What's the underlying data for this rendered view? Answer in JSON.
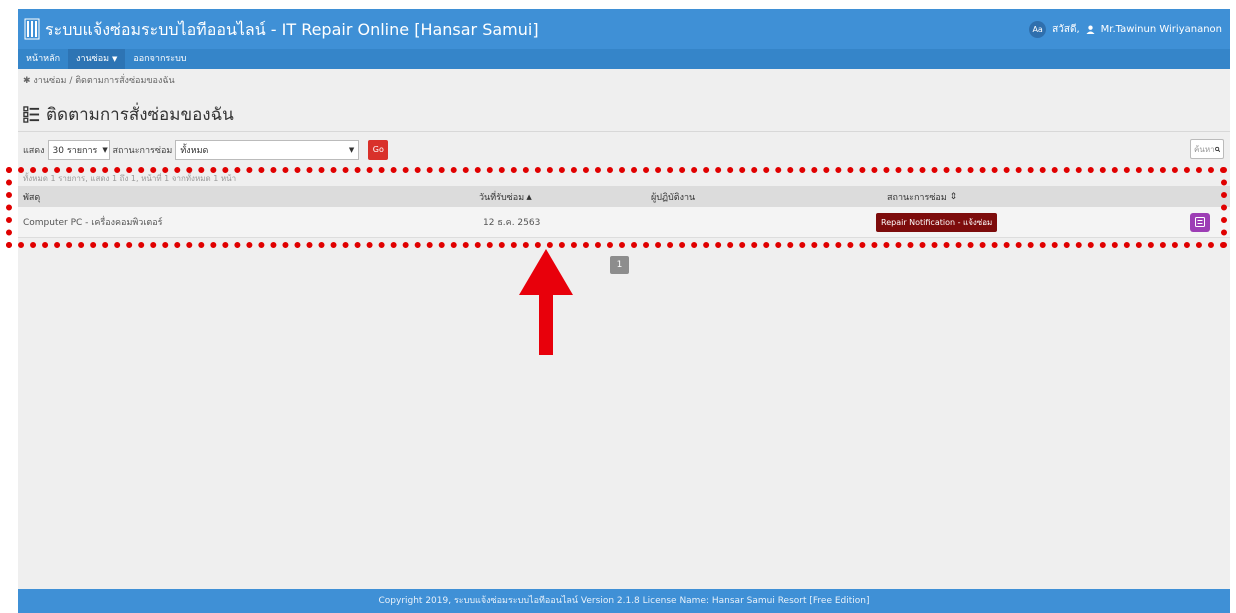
{
  "header": {
    "title": "ระบบแจ้งซ่อมระบบไอทีออนไลน์ - IT Repair Online [Hansar Samui]",
    "lang_badge": "Aa",
    "greeting": "สวัสดี,",
    "user_name": "Mr.Tawinun Wiriyananon"
  },
  "nav": {
    "items": [
      {
        "label": "หน้าหลัก"
      },
      {
        "label": "งานซ่อม"
      },
      {
        "label": "ออกจากระบบ"
      }
    ]
  },
  "breadcrumb": "งานซ่อม / ติดตามการสั่งซ่อมของฉัน",
  "page_title": "ติดตามการสั่งซ่อมของฉัน",
  "filters": {
    "show_label": "แสดง",
    "show_value": "30 รายการ",
    "status_label": "สถานะการซ่อม",
    "status_value": "ทั้งหมด",
    "go_label": "Go",
    "search_placeholder": "ค้นหา"
  },
  "table": {
    "summary": "ทั้งหมด 1 รายการ, แสดง 1 ถึง 1, หน้าที่ 1 จากทั้งหมด 1 หน้า",
    "columns": [
      "พัสดุ",
      "วันที่รับซ่อม",
      "ผู้ปฏิบัติงาน",
      "สถานะการซ่อม"
    ],
    "rows": [
      {
        "item": "Computer PC - เครื่องคอมพิวเตอร์",
        "date": "12 ธ.ค. 2563",
        "worker": "",
        "status": "Repair Notification - แจ้งซ่อม"
      }
    ]
  },
  "pagination": {
    "current": "1"
  },
  "footer": "Copyright 2019, ระบบแจ้งซ่อมระบบไอทีออนไลน์ Version 2.1.8 License Name: Hansar Samui Resort [Free Edition]",
  "colors": {
    "header": "#3f90d6",
    "nav": "#3585c9",
    "go_button": "#d9312b",
    "status_badge": "#7d0c0c",
    "action_button": "#9d3eb5",
    "annotation": "#e00000"
  }
}
